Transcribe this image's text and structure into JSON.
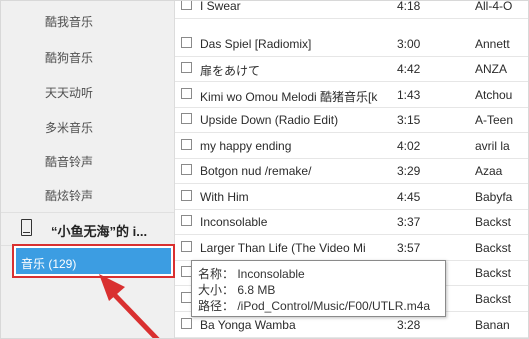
{
  "sidebar": {
    "items": [
      {
        "label": "酷我音乐"
      },
      {
        "label": "酷狗音乐"
      },
      {
        "label": "天天动听"
      },
      {
        "label": "多米音乐"
      },
      {
        "label": "酷音铃声"
      },
      {
        "label": "酷炫铃声"
      }
    ],
    "device": {
      "name": "“小鱼无海”的 i...",
      "icon": "ipod-device-icon"
    },
    "music": {
      "label": "音乐 (129)",
      "selected": true
    }
  },
  "colors": {
    "selected_bg": "#3c9de2",
    "highlight_box": "#d93030",
    "arrow": "#d93030"
  },
  "songs": [
    {
      "name": "I Swear",
      "time": "4:18",
      "artist": "All-4-O"
    },
    {
      "name": "Das Spiel [Radiomix]",
      "time": "3:00",
      "artist": "Annett"
    },
    {
      "name": "扉をあけて",
      "time": "4:42",
      "artist": "ANZA"
    },
    {
      "name": "Kimi wo Omou Melodi 酷猪音乐[k",
      "time": "1:43",
      "artist": "Atchou"
    },
    {
      "name": "Upside Down (Radio Edit)",
      "time": "3:15",
      "artist": "A-Teen"
    },
    {
      "name": "my happy ending",
      "time": "4:02",
      "artist": "avril la"
    },
    {
      "name": "Botgon nud /remake/",
      "time": "3:29",
      "artist": "Azaa"
    },
    {
      "name": "With Him",
      "time": "4:45",
      "artist": "Babyfa"
    },
    {
      "name": "Inconsolable",
      "time": "3:37",
      "artist": "Backst"
    },
    {
      "name": "Larger Than Life (The Video Mi",
      "time": "3:57",
      "artist": "Backst"
    },
    {
      "name": "",
      "time": "",
      "artist": "Backst"
    },
    {
      "name": "",
      "time": "",
      "artist": "Backst"
    },
    {
      "name": "Ba Yonga Wamba",
      "time": "3:28",
      "artist": "Banan"
    }
  ],
  "tooltip": {
    "name_line": "名称： Inconsolable",
    "size_line": "大小： 6.8 MB",
    "path_line": "路径： /iPod_Control/Music/F00/UTLR.m4a"
  }
}
